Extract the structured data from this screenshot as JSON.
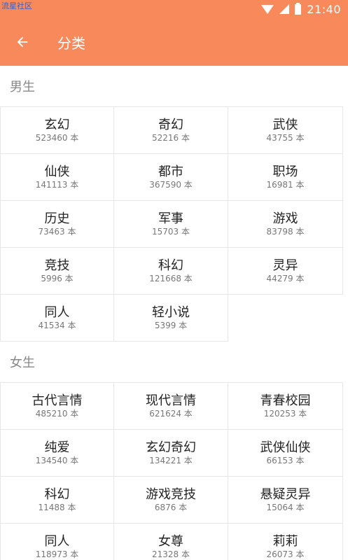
{
  "status_bar": {
    "watermark": "流星社区",
    "time": "21:40"
  },
  "app_bar": {
    "title": "分类",
    "back_icon": "arrow-left-icon"
  },
  "colors": {
    "accent": "#f7895a",
    "divider": "#e6e6e6",
    "section_text": "#888888"
  },
  "sections": [
    {
      "title": "男生",
      "items": [
        {
          "name": "玄幻",
          "count": "523460 本"
        },
        {
          "name": "奇幻",
          "count": "52216 本"
        },
        {
          "name": "武侠",
          "count": "43755 本"
        },
        {
          "name": "仙侠",
          "count": "141113 本"
        },
        {
          "name": "都市",
          "count": "367590 本"
        },
        {
          "name": "职场",
          "count": "16981 本"
        },
        {
          "name": "历史",
          "count": "73463 本"
        },
        {
          "name": "军事",
          "count": "15703 本"
        },
        {
          "name": "游戏",
          "count": "83798 本"
        },
        {
          "name": "竞技",
          "count": "5996 本"
        },
        {
          "name": "科幻",
          "count": "121668 本"
        },
        {
          "name": "灵异",
          "count": "44279 本"
        },
        {
          "name": "同人",
          "count": "41534 本"
        },
        {
          "name": "轻小说",
          "count": "5399 本"
        }
      ]
    },
    {
      "title": "女生",
      "items": [
        {
          "name": "古代言情",
          "count": "485210 本"
        },
        {
          "name": "现代言情",
          "count": "621624 本"
        },
        {
          "name": "青春校园",
          "count": "120253 本"
        },
        {
          "name": "纯爱",
          "count": "134540 本"
        },
        {
          "name": "玄幻奇幻",
          "count": "134221 本"
        },
        {
          "name": "武侠仙侠",
          "count": "66153 本"
        },
        {
          "name": "科幻",
          "count": "11488 本"
        },
        {
          "name": "游戏竞技",
          "count": "6876 本"
        },
        {
          "name": "悬疑灵异",
          "count": "15064 本"
        },
        {
          "name": "同人",
          "count": "118973 本"
        },
        {
          "name": "女尊",
          "count": "21328 本"
        },
        {
          "name": "莉莉",
          "count": "26073 本"
        }
      ]
    }
  ]
}
